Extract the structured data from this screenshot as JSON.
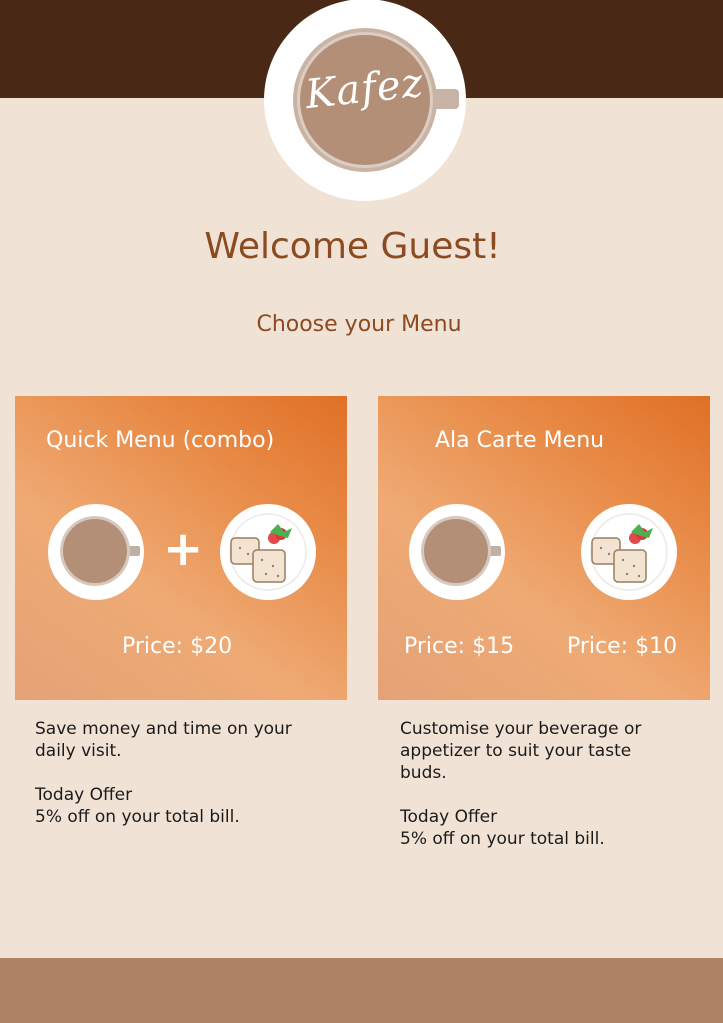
{
  "brand": {
    "logo_text": "Kafez",
    "colors": {
      "header": "#4a2816",
      "footer": "#ae8465",
      "background": "#f1e2d6",
      "heading": "#8b4a1f",
      "card_gradient": [
        "#e4a276",
        "#efaa74",
        "#e88a46",
        "#e07026"
      ]
    }
  },
  "header": {
    "welcome": "Welcome Guest!",
    "subtitle": "Choose your Menu"
  },
  "cards": {
    "quick": {
      "title": "Quick Menu (combo)",
      "plus": "+",
      "price": "Price: $20",
      "icons": [
        "coffee-cup-icon",
        "toast-plate-icon"
      ],
      "desc_line1": "Save money and time on your daily visit.",
      "offer_title": "Today Offer",
      "offer_text": "5% off on your total bill."
    },
    "alacarte": {
      "title": "Ala Carte Menu",
      "price_beverage": "Price: $15",
      "price_appetizer": "Price: $10",
      "icons": [
        "coffee-cup-icon",
        "toast-plate-icon"
      ],
      "desc_line1": "Customise your beverage or appetizer to suit your taste buds.",
      "offer_title": "Today Offer",
      "offer_text": "5% off on your total bill."
    }
  }
}
